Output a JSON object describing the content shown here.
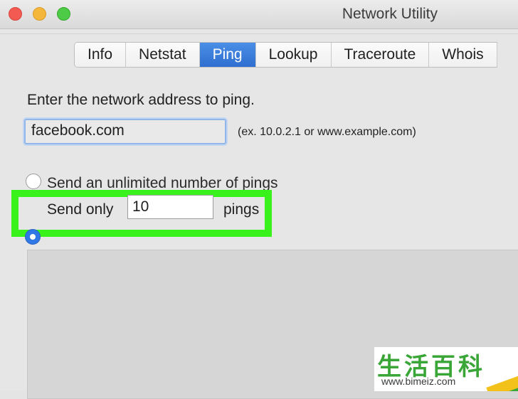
{
  "window": {
    "title": "Network Utility"
  },
  "tabs": [
    {
      "label": "Info",
      "active": false
    },
    {
      "label": "Netstat",
      "active": false
    },
    {
      "label": "Ping",
      "active": true
    },
    {
      "label": "Lookup",
      "active": false
    },
    {
      "label": "Traceroute",
      "active": false
    },
    {
      "label": "Whois",
      "active": false
    }
  ],
  "ping": {
    "prompt": "Enter the network address to ping.",
    "address_value": "facebook.com",
    "address_hint": "(ex. 10.0.2.1 or www.example.com)",
    "unlimited_label": "Send an unlimited number of pings",
    "send_only_label": "Send only",
    "count_value": "10",
    "pings_label": "pings",
    "selected_option": "send_only"
  },
  "watermark": {
    "logo": "生活百科",
    "url": "www.bimeiz.com"
  },
  "colors": {
    "tab_active": "#2f6fd0",
    "radio_selected": "#2f78e6",
    "highlight": "#39f21c",
    "close": "#f25a52",
    "minimize": "#f4b63b",
    "maximize": "#4ecb46"
  }
}
